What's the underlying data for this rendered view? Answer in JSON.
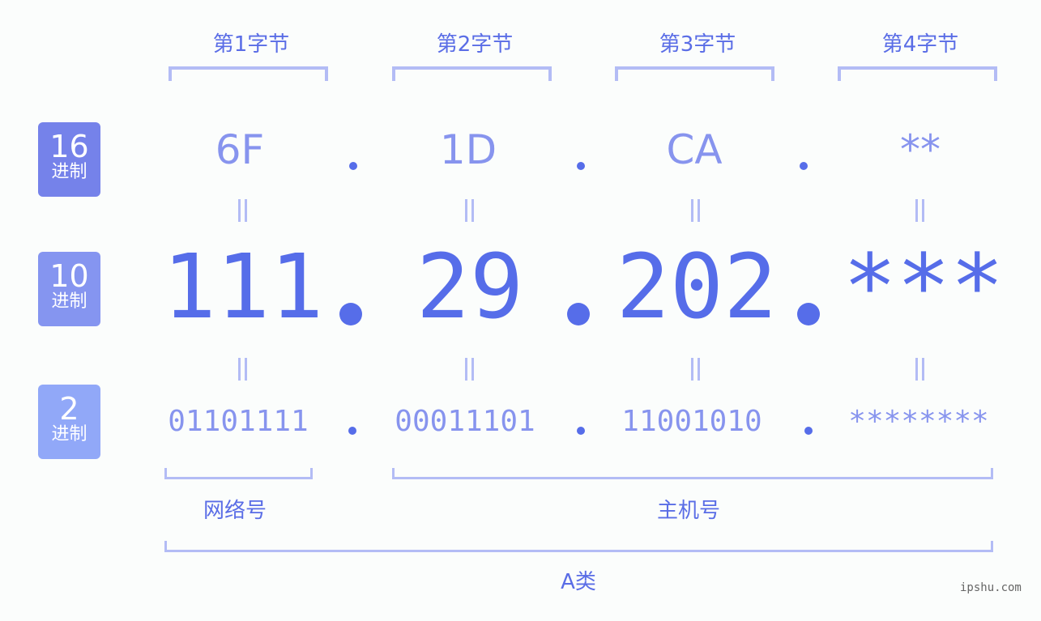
{
  "bytes": [
    {
      "label": "第1字节",
      "hex": "6F",
      "dec": "111",
      "bin": "01101111"
    },
    {
      "label": "第2字节",
      "hex": "1D",
      "dec": "29",
      "bin": "00011101"
    },
    {
      "label": "第3字节",
      "hex": "CA",
      "dec": "202",
      "bin": "11001010"
    },
    {
      "label": "第4字节",
      "hex": "**",
      "dec": "***",
      "bin": "********"
    }
  ],
  "badges": {
    "hex": {
      "num": "16",
      "label": "进制",
      "color": "#7582ea"
    },
    "dec": {
      "num": "10",
      "label": "进制",
      "color": "#8595f0"
    },
    "bin": {
      "num": "2",
      "label": "进制",
      "color": "#91a8f8"
    }
  },
  "segments": {
    "network": "网络号",
    "host": "主机号",
    "class": "A类"
  },
  "watermark": "ipshu.com",
  "colors": {
    "primary": "#566de9",
    "light": "#8794ee",
    "bracket": "#b3bcf5"
  }
}
